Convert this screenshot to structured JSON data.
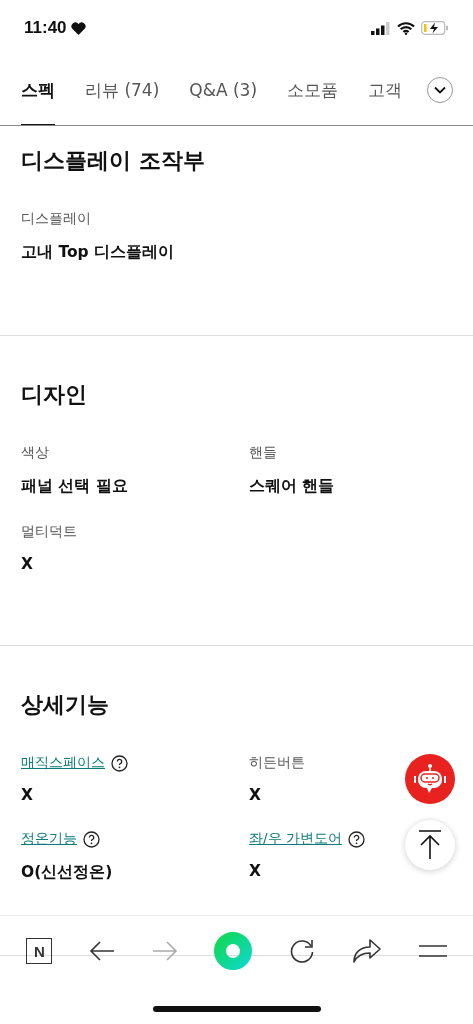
{
  "status_bar": {
    "time": "11:40"
  },
  "tabs": [
    {
      "label": "스펙",
      "selected": true
    },
    {
      "label": "리뷰 (74)",
      "selected": false
    },
    {
      "label": "Q&A (3)",
      "selected": false
    },
    {
      "label": "소모품",
      "selected": false
    },
    {
      "label": "고객",
      "selected": false
    }
  ],
  "sections": [
    {
      "title": "디스플레이 조작부",
      "items": [
        {
          "label": "디스플레이",
          "value": "고내 Top 디스플레이",
          "kind": "plain"
        }
      ]
    },
    {
      "title": "디자인",
      "items": [
        {
          "label": "색상",
          "value": "패널 선택 필요",
          "kind": "plain"
        },
        {
          "label": "핸들",
          "value": "스퀘어 핸들",
          "kind": "plain"
        },
        {
          "label": "멀티덕트",
          "value": "X",
          "kind": "plain"
        }
      ]
    },
    {
      "title": "상세기능",
      "items": [
        {
          "label": "매직스페이스",
          "value": "X",
          "kind": "help"
        },
        {
          "label": "히든버튼",
          "value": "X",
          "kind": "plain"
        },
        {
          "label": "정온기능",
          "value": "O(신선정온)",
          "kind": "help"
        },
        {
          "label": "좌/우 가변도어",
          "value": "X",
          "kind": "help"
        }
      ]
    }
  ],
  "toolbar": {
    "logo": "N",
    "forward_disabled": true
  }
}
